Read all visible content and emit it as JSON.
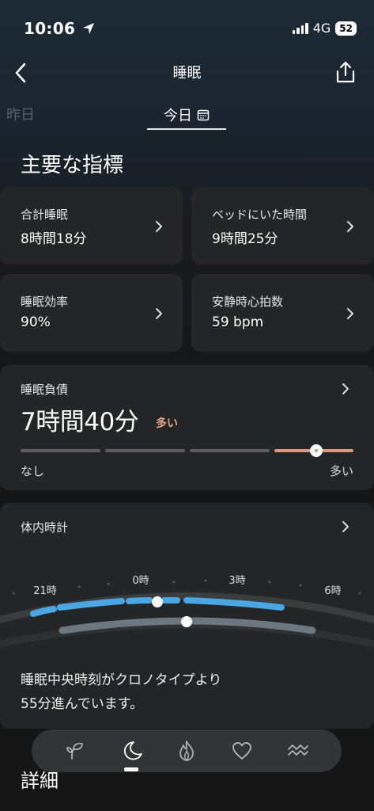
{
  "status": {
    "time": "10:06",
    "network": "4G",
    "battery": "52"
  },
  "header": {
    "title": "睡眠"
  },
  "date_tabs": {
    "previous": "昨日",
    "current": "今日"
  },
  "section_title": "主要な指標",
  "metrics": [
    {
      "label": "合計睡眠",
      "value": "8時間18分"
    },
    {
      "label": "ベッドにいた時間",
      "value": "9時間25分"
    },
    {
      "label": "睡眠効率",
      "value": "90%"
    },
    {
      "label": "安静時心拍数",
      "value": "59 bpm"
    }
  ],
  "sleep_debt": {
    "title": "睡眠負債",
    "value": "7時間40分",
    "level": "多い",
    "scale_min": "なし",
    "scale_max": "多い",
    "active_segment": 4,
    "segment_count": 4,
    "accent_color": "#e2a586"
  },
  "body_clock": {
    "title": "体内時計",
    "hour_labels": [
      "21時",
      "0時",
      "3時",
      "6時"
    ],
    "description_line1": "睡眠中央時刻がクロノタイプより",
    "description_line2": "55分進んでいます。",
    "sleep_color": "#4aa7e4"
  },
  "details_title": "詳細",
  "tab_bar": {
    "items": [
      "sprout-icon",
      "moon-icon",
      "flame-icon",
      "heart-icon",
      "waves-icon"
    ],
    "active": "moon-icon"
  }
}
